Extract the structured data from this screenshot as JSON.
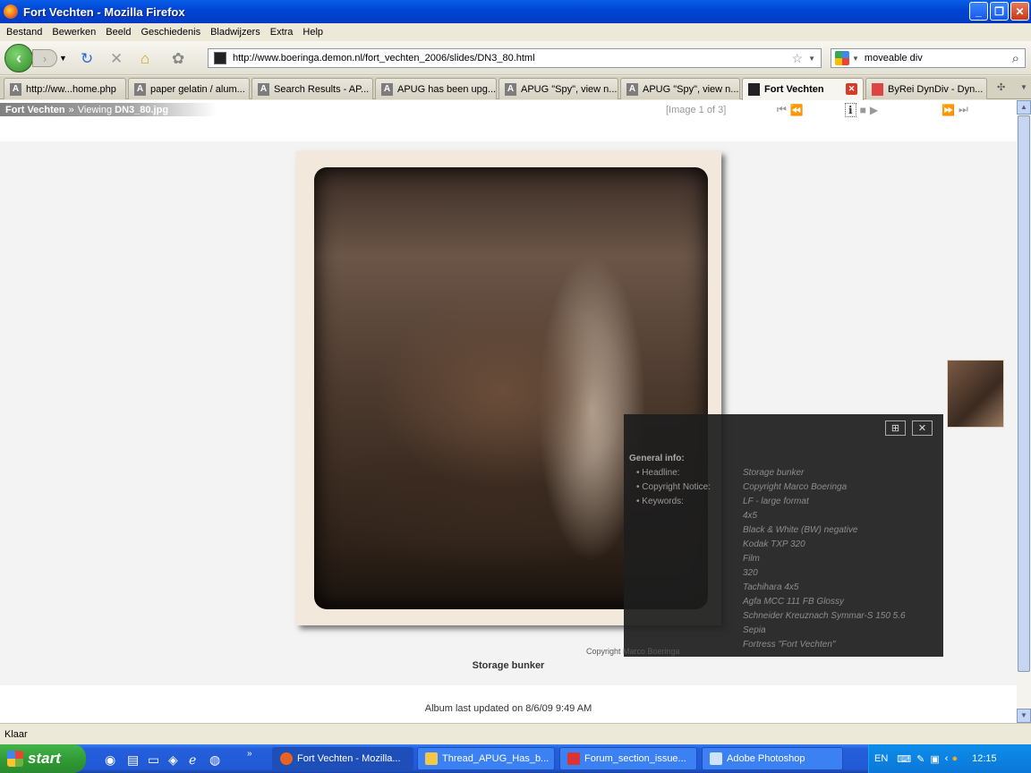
{
  "window": {
    "title": "Fort Vechten - Mozilla Firefox"
  },
  "menu": [
    "Bestand",
    "Bewerken",
    "Beeld",
    "Geschiedenis",
    "Bladwijzers",
    "Extra",
    "Help"
  ],
  "toolbar": {
    "url": "http://www.boeringa.demon.nl/fort_vechten_2006/slides/DN3_80.html",
    "search_value": "moveable div"
  },
  "tabs": [
    {
      "label": "http://ww...home.php"
    },
    {
      "label": "paper gelatin / alum..."
    },
    {
      "label": "Search Results - AP..."
    },
    {
      "label": "APUG has been upg..."
    },
    {
      "label": "APUG \"Spy\", view n..."
    },
    {
      "label": "APUG \"Spy\", view n..."
    },
    {
      "label": "Fort Vechten"
    },
    {
      "label": "ByRei DynDiv - Dyn..."
    }
  ],
  "page": {
    "breadcrumb_album": "Fort Vechten",
    "breadcrumb_sep": "»",
    "breadcrumb_viewing": "Viewing",
    "breadcrumb_file": "DN3_80.jpg",
    "image_count": "[Image 1 of 3]",
    "caption": "Storage bunker",
    "footer": "Album last updated on 8/6/09 9:49 AM",
    "watermark": "Copyright Marco Boeringa"
  },
  "info": {
    "header": "General info:",
    "headline_label": "• Headline:",
    "headline": "Storage bunker",
    "copyright_label": "• Copyright Notice:",
    "copyright": "Copyright Marco Boeringa",
    "keywords_label": "• Keywords:",
    "keywords": [
      "LF - large format",
      "4x5",
      "Black & White (BW) negative",
      "Kodak TXP 320",
      "Film",
      "320",
      "Tachihara 4x5",
      "Agfa MCC 111 FB Glossy",
      "Schneider Kreuznach Symmar-S 150 5.6",
      "Sepia",
      "Fortress \"Fort Vechten\""
    ]
  },
  "status": {
    "text": "Klaar"
  },
  "taskbar": {
    "start": "start",
    "tasks": [
      {
        "label": "Fort Vechten - Mozilla..."
      },
      {
        "label": "Thread_APUG_Has_b..."
      },
      {
        "label": "Forum_section_issue..."
      },
      {
        "label": "Adobe Photoshop"
      }
    ],
    "lang": "EN",
    "clock": "12:15"
  }
}
